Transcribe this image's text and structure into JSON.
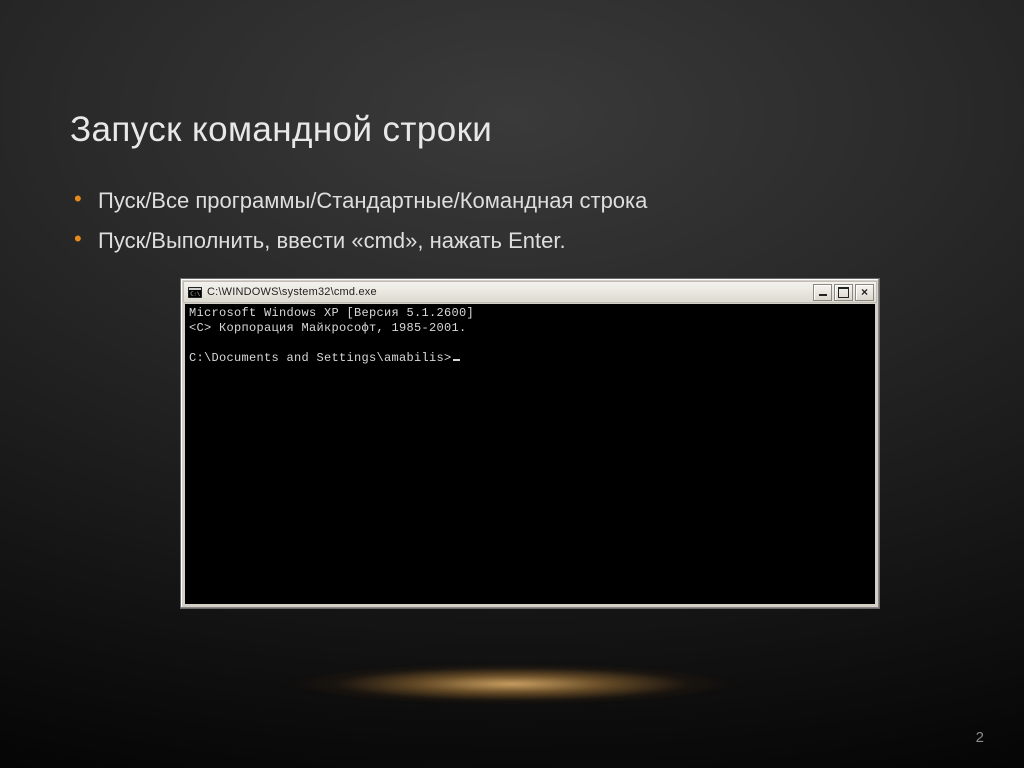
{
  "slide": {
    "title": "Запуск командной строки",
    "bullets": [
      "Пуск/Все программы/Стандартные/Командная строка",
      "Пуск/Выполнить, ввести «cmd», нажать Enter."
    ],
    "page_number": "2"
  },
  "cmd_window": {
    "title": "C:\\WINDOWS\\system32\\cmd.exe",
    "lines": [
      "Microsoft Windows XP [Версия 5.1.2600]",
      "<C> Корпорация Майкрософт, 1985-2001.",
      "",
      "C:\\Documents and Settings\\amabilis>"
    ]
  }
}
